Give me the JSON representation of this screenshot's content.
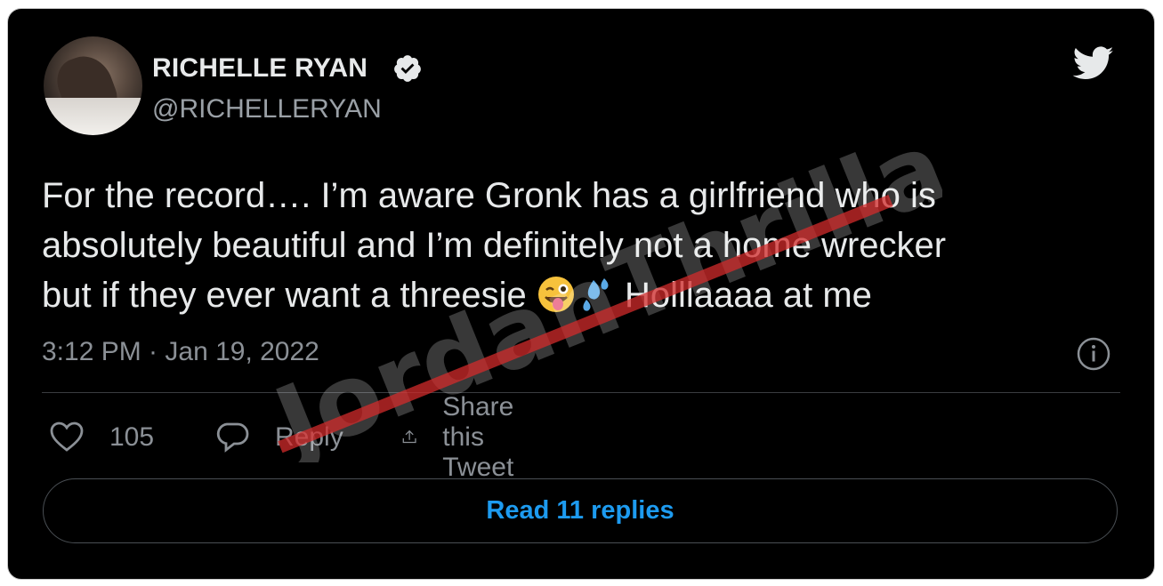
{
  "tweet": {
    "display_name": "RICHELLE RYAN",
    "handle": "@RICHELLERYAN",
    "verified_icon": "verified-badge-icon",
    "bird_icon": "twitter-bird-icon",
    "body_lines": [
      "For the record…. I’m aware Gronk has a girlfriend who is",
      "absolutely beautiful and I’m definitely not a home wrecker",
      "but if they ever want a threesie",
      " Holllaaaa at me"
    ],
    "emojis": [
      "winking-face-with-tongue-emoji",
      "sweat-droplets-emoji"
    ],
    "timestamp": "3:12 PM · Jan 19, 2022"
  },
  "actions": {
    "like_count": "105",
    "reply_label": "Reply",
    "share_label": "Share this Tweet"
  },
  "read_replies_label": "Read 11 replies",
  "watermark_text": "JordanThrilla.",
  "colors": {
    "background": "#000000",
    "text": "#e7e9ea",
    "muted": "#8b9096",
    "accent": "#1d9bf0",
    "watermark_red": "#d22b2b"
  }
}
